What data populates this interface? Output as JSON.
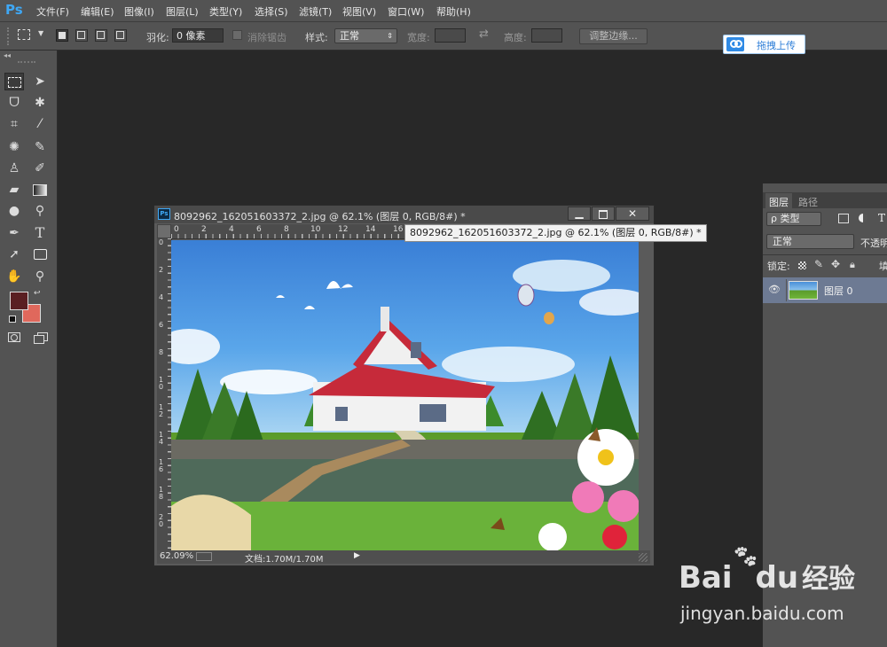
{
  "app": {
    "logo": "Ps"
  },
  "menu": [
    "文件(F)",
    "编辑(E)",
    "图像(I)",
    "图层(L)",
    "类型(Y)",
    "选择(S)",
    "滤镜(T)",
    "视图(V)",
    "窗口(W)",
    "帮助(H)"
  ],
  "options": {
    "feather_label": "羽化:",
    "feather_value": "0 像素",
    "antialias_label": "消除锯齿",
    "style_label": "样式:",
    "style_value": "正常",
    "width_label": "宽度:",
    "height_label": "高度:",
    "refine_edge_button": "调整边缘..."
  },
  "upload_button": "拖拽上传",
  "colors": {
    "foreground": "#5a1f22",
    "background": "#e0685c",
    "accent": "#3fa8f5"
  },
  "document": {
    "title": "8092962_162051603372_2.jpg @ 62.1% (图层 0, RGB/8#) *",
    "tooltip": "8092962_162051603372_2.jpg @ 62.1% (图层 0, RGB/8#) *",
    "zoom": "62.09%",
    "doc_size": "文档:1.70M/1.70M",
    "ruler_h": [
      "0",
      "2",
      "4",
      "6",
      "8",
      "10",
      "12",
      "14",
      "16"
    ],
    "ruler_v": [
      "0",
      "2",
      "4",
      "6",
      "8",
      "1\n0",
      "1\n2",
      "1\n4",
      "1\n6",
      "1\n8",
      "2\n0"
    ]
  },
  "layers_panel": {
    "tabs": [
      "图层",
      "路径"
    ],
    "filter_kind": "ρ 类型",
    "blend_mode": "正常",
    "opacity_label": "不透明",
    "lock_label": "锁定:",
    "fill_label": "填",
    "layer_name": "图层 0"
  },
  "watermark": {
    "logo_text": "Bai",
    "logo_text2": "du",
    "cn_text": "经验",
    "url": "jingyan.baidu.com"
  }
}
